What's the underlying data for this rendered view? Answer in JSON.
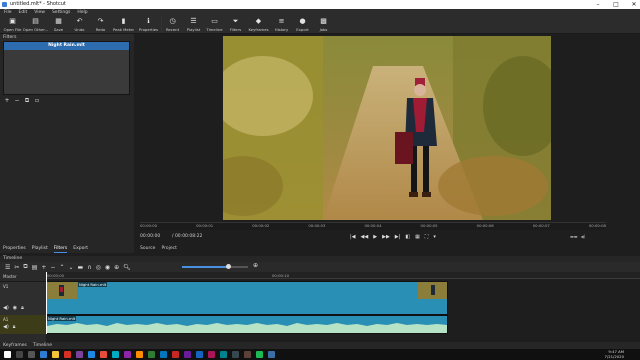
{
  "window": {
    "title": "untitled.mlt* - Shotcut"
  },
  "menu": [
    "File",
    "Edit",
    "View",
    "Settings",
    "Help"
  ],
  "toolbar": [
    {
      "label": "Open File",
      "icon": "folder-icon"
    },
    {
      "label": "Open Other...",
      "icon": "folder-plus-icon"
    },
    {
      "label": "Save",
      "icon": "save-icon"
    },
    {
      "label": "Undo",
      "icon": "undo-icon"
    },
    {
      "label": "Redo",
      "icon": "redo-icon"
    },
    {
      "label": "Peak Meter",
      "icon": "meter-icon"
    },
    {
      "label": "Properties",
      "icon": "info-icon"
    },
    {
      "label": "Recent",
      "icon": "clock-icon"
    },
    {
      "label": "Playlist",
      "icon": "list-icon"
    },
    {
      "label": "Timeline",
      "icon": "timeline-icon"
    },
    {
      "label": "Filters",
      "icon": "filter-icon"
    },
    {
      "label": "Keyframes",
      "icon": "keyframes-icon"
    },
    {
      "label": "History",
      "icon": "history-icon"
    },
    {
      "label": "Export",
      "icon": "export-icon"
    },
    {
      "label": "Jobs",
      "icon": "jobs-icon"
    }
  ],
  "filters": {
    "header": "Filters",
    "selected_item": "Night Rain.mlt",
    "buttons": [
      "add-filter",
      "remove-filter",
      "copy-filter",
      "deselect-filter"
    ]
  },
  "left_tabs": [
    "Properties",
    "Playlist",
    "Filters",
    "Export"
  ],
  "left_tabs_active": "Filters",
  "player": {
    "ruler_ticks": [
      "00:00:00",
      "00:00:01",
      "00:00:02",
      "00:00:03",
      "00:00:04",
      "00:00:05",
      "00:00:06",
      "00:00:07",
      "00:00:08"
    ],
    "position": "00:00:00",
    "duration": "/ 00:00:08:22",
    "tabs": [
      "Source",
      "Project"
    ],
    "transport": [
      "|◀",
      "◀◀",
      "▶",
      "▶▶",
      "▶|",
      "◧",
      "▦",
      "⛶",
      "▾"
    ]
  },
  "timeline": {
    "header": "Timeline",
    "master_label": "Master",
    "ruler_ticks": [
      "00:00:00",
      "00:00:10"
    ],
    "tracks": [
      {
        "name": "V1",
        "clip_name": "Night Rain.mlt",
        "clip_name_right": "Night Rain.mlt"
      },
      {
        "name": "A1",
        "clip_name": "Night Rain.mlt"
      }
    ],
    "zoom_level": 0.7
  },
  "bottom_tabs": [
    "Keyframes",
    "Timeline"
  ],
  "taskbar": {
    "time": "9:47 AM",
    "date": "7/21/2020"
  }
}
